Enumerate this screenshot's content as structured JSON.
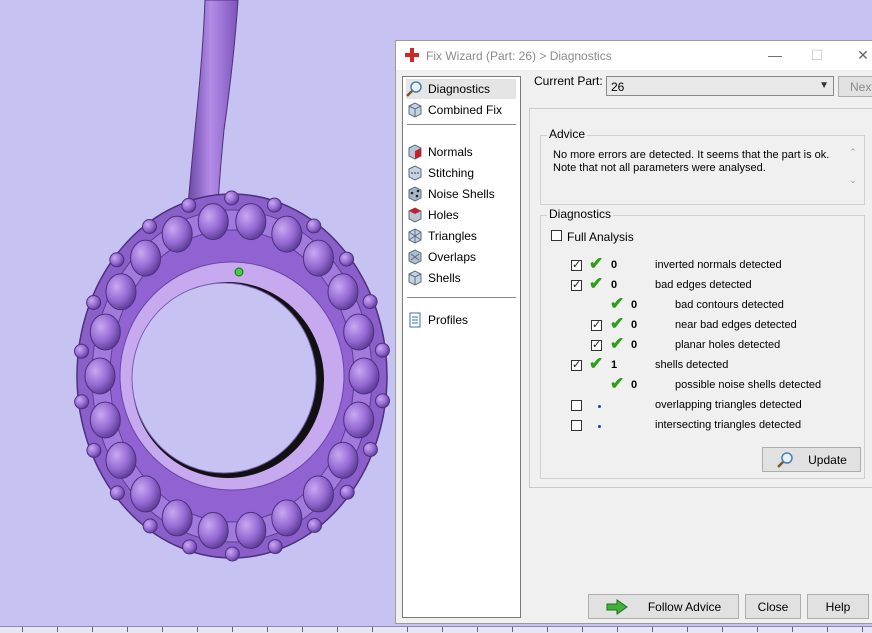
{
  "window": {
    "title": "Fix Wizard (Part: 26) > Diagnostics",
    "minimize": "—",
    "maximize": "☐",
    "close": "✕"
  },
  "nav": {
    "items": [
      {
        "label": "Diagnostics",
        "icon": "magnifier-icon"
      },
      {
        "label": "Combined Fix",
        "icon": "cube-icon"
      },
      {
        "label": "Normals",
        "icon": "normals-cube-icon"
      },
      {
        "label": "Stitching",
        "icon": "stitching-cube-icon"
      },
      {
        "label": "Noise Shells",
        "icon": "noise-shells-icon"
      },
      {
        "label": "Holes",
        "icon": "holes-cube-icon"
      },
      {
        "label": "Triangles",
        "icon": "triangles-icon"
      },
      {
        "label": "Overlaps",
        "icon": "overlaps-icon"
      },
      {
        "label": "Shells",
        "icon": "shells-icon"
      },
      {
        "label": "Profiles",
        "icon": "document-icon"
      }
    ]
  },
  "current_part": {
    "label": "Current Part:",
    "value": "26"
  },
  "next_label": "Next",
  "advice": {
    "title": "Advice",
    "text": "No more errors are detected. It seems that the part is ok. Note that not all parameters were analysed."
  },
  "diagnostics": {
    "title": "Diagnostics",
    "full_analysis": "Full Analysis",
    "rows": [
      {
        "count": "0",
        "label": "inverted normals detected",
        "checked": true,
        "status": "ok"
      },
      {
        "count": "0",
        "label": "bad edges detected",
        "checked": true,
        "status": "ok"
      },
      {
        "count": "0",
        "label": "bad contours detected",
        "checked": false,
        "status": "ok"
      },
      {
        "count": "0",
        "label": "near bad edges detected",
        "checked": true,
        "status": "ok"
      },
      {
        "count": "0",
        "label": "planar holes detected",
        "checked": true,
        "status": "ok"
      },
      {
        "count": "1",
        "label": "shells detected",
        "checked": true,
        "status": "ok"
      },
      {
        "count": "0",
        "label": "possible noise shells detected",
        "checked": false,
        "status": "ok"
      },
      {
        "count": "",
        "label": "overlapping triangles detected",
        "checked": false,
        "status": "pending"
      },
      {
        "count": "",
        "label": "intersecting triangles detected",
        "checked": false,
        "status": "pending"
      }
    ],
    "update_label": "Update"
  },
  "buttons": {
    "follow_advice": "Follow Advice",
    "close": "Close",
    "help": "Help"
  },
  "colors": {
    "background": "#c6c3f3",
    "part": "#9b6fd8",
    "ok_tick": "#2f9e1a"
  }
}
